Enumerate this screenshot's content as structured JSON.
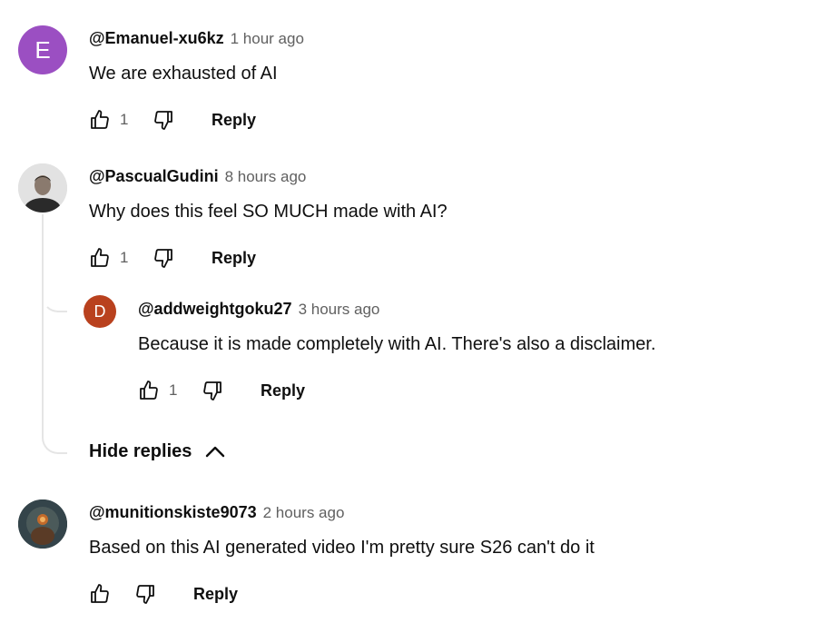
{
  "colors": {
    "avatar_emanuel": "#9b4fc2",
    "avatar_addweight": "#b9411e",
    "text_primary": "#0f0f0f",
    "text_secondary": "#606060",
    "thread_line": "#e5e5e5"
  },
  "comments": [
    {
      "avatar_letter": "E",
      "author": "@Emanuel-xu6kz",
      "time": "1 hour ago",
      "text": "We are exhausted of AI",
      "likes": "1",
      "reply_label": "Reply"
    },
    {
      "avatar_icon": "user-photo-icon",
      "author": "@PascualGudini",
      "time": "8 hours ago",
      "text": "Why does this feel SO MUCH made with AI?",
      "likes": "1",
      "reply_label": "Reply",
      "replies": [
        {
          "avatar_letter": "D",
          "author": "@addweightgoku27",
          "time": "3 hours ago",
          "text": "Because it is made completely with AI. There's also a disclaimer.",
          "likes": "1",
          "reply_label": "Reply"
        }
      ],
      "hide_replies_label": "Hide replies"
    },
    {
      "avatar_icon": "user-photo-icon",
      "author": "@munitionskiste9073",
      "time": "2 hours ago",
      "text": "Based on this AI generated video I'm pretty sure S26 can't do it",
      "likes": "",
      "reply_label": "Reply"
    }
  ]
}
